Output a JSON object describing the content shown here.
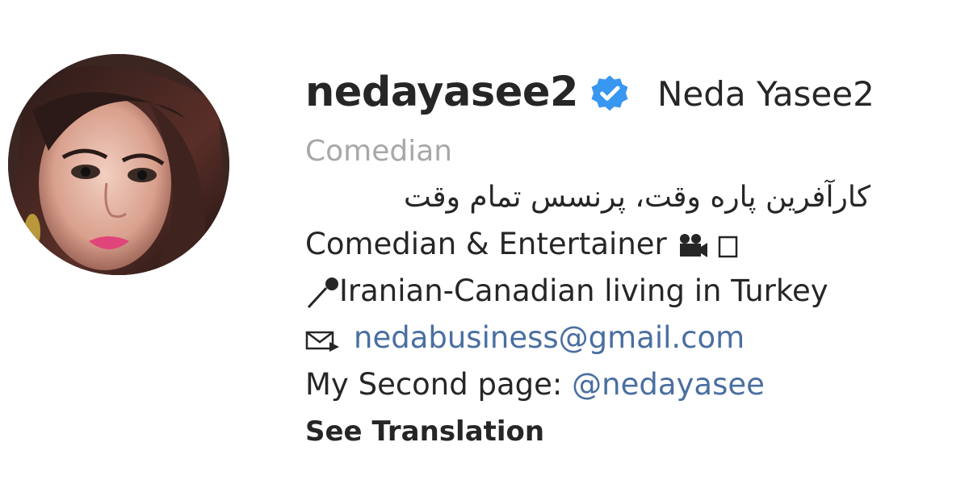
{
  "profile": {
    "username": "nedayasee2",
    "full_name": "Neda Yasee2",
    "verified_icon": "verified-badge-icon",
    "category": "Comedian",
    "bio": {
      "line_persian": "کارآفرین پاره وقت، پرنسس تمام وقت",
      "line_comedian": "Comedian & Entertainer",
      "line_comedian_icons": [
        "movie-camera-icon",
        "empty-box-icon"
      ],
      "line_location": "Iranian-Canadian living in Turkey",
      "line_location_icon": "pushpin-icon",
      "email_icon": "envelope-icon",
      "email": "nedabusiness@gmail.com",
      "second_page_label": "My Second page: ",
      "second_page_handle": "@nedayasee"
    },
    "see_translation": "See Translation"
  },
  "colors": {
    "text": "#262626",
    "muted": "#a8a8a8",
    "link": "#4a6fa0",
    "verified": "#3897f0"
  }
}
